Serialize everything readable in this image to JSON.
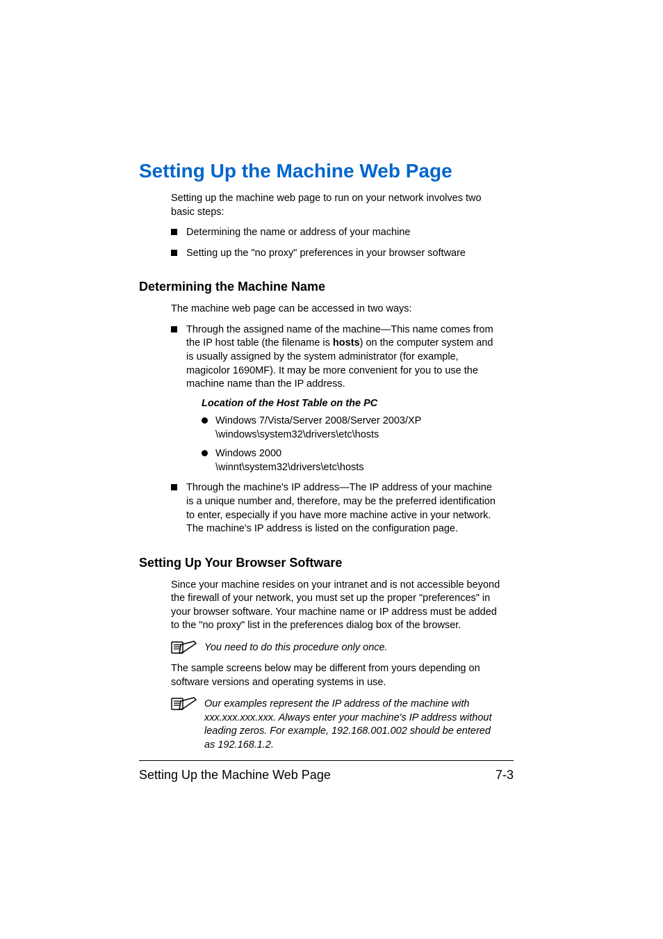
{
  "mainHeading": "Setting Up the Machine Web Page",
  "introPara": "Setting up the machine web page to run on your network involves two basic steps:",
  "introBullets": [
    "Determining the name or address of your machine",
    "Setting up the \"no proxy\" preferences in your browser software"
  ],
  "section1": {
    "heading": "Determining the Machine Name",
    "lead": "The machine web page can be accessed in two ways:",
    "bullet1_pre": "Through the assigned name of the machine—This name comes from the IP host table (the filename is ",
    "bullet1_bold": "hosts",
    "bullet1_post": ") on the computer system and is usually assigned by the system administrator (for example, magicolor 1690MF). It may be more convenient for you to use the machine name than the IP address.",
    "hostTableHead": "Location of the Host Table on the PC",
    "hostItems": [
      {
        "label": "Windows 7/Vista/Server 2008/Server 2003/XP",
        "path": "\\windows\\system32\\drivers\\etc\\hosts"
      },
      {
        "label": "Windows 2000",
        "path": "\\winnt\\system32\\drivers\\etc\\hosts"
      }
    ],
    "bullet2": "Through the machine's IP address—The IP address of your machine is a unique number and, therefore, may be the preferred identification to enter, especially if you have more machine active in your network. The machine's IP address is listed on the configuration page."
  },
  "section2": {
    "heading": "Setting Up Your Browser Software",
    "para1": "Since your machine resides on your intranet and is not accessible beyond the firewall of your network, you must set up the proper \"preferences\" in your browser software. Your machine name or IP address must be added to the \"no proxy\" list in the preferences dialog box of the browser.",
    "note1": "You need to do this procedure only once.",
    "para2": "The sample screens below may be different from yours depending on software versions and operating systems in use.",
    "note2": "Our examples represent the IP address of the machine with xxx.xxx.xxx.xxx. Always enter your machine's IP address without leading zeros. For example, 192.168.001.002 should be entered as 192.168.1.2."
  },
  "footer": {
    "left": "Setting Up the Machine Web Page",
    "right": "7-3"
  }
}
